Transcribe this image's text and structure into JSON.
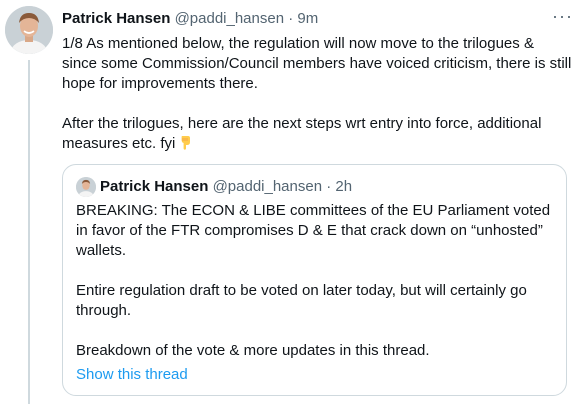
{
  "tweet": {
    "author_name": "Patrick Hansen",
    "author_handle": "@paddi_hansen",
    "separator": "·",
    "time": "9m",
    "more_icon": "more-icon",
    "paragraphs": [
      "1/8 As mentioned below, the regulation will now move to the trilogues & since some Commission/Council members have voiced criticism, there is still hope for improvements there.",
      "After the trilogues, here are the next steps wrt entry into force, additional measures etc. fyi"
    ],
    "emoji": "backhand-index-pointing-down"
  },
  "quoted_tweet": {
    "author_name": "Patrick Hansen",
    "author_handle": "@paddi_hansen",
    "separator": "·",
    "time": "2h",
    "paragraphs": [
      "BREAKING: The ECON & LIBE committees of the EU Parliament voted in favor of the FTR compromises D & E that crack down on “unhosted” wallets.",
      "Entire regulation draft to be voted on later today, but will certainly go through.",
      "Breakdown of the vote & more updates in this thread."
    ],
    "show_thread": "Show this thread"
  },
  "colors": {
    "text": "#0f1419",
    "muted": "#536471",
    "link": "#1d9bf0",
    "border": "#cfd9de"
  }
}
